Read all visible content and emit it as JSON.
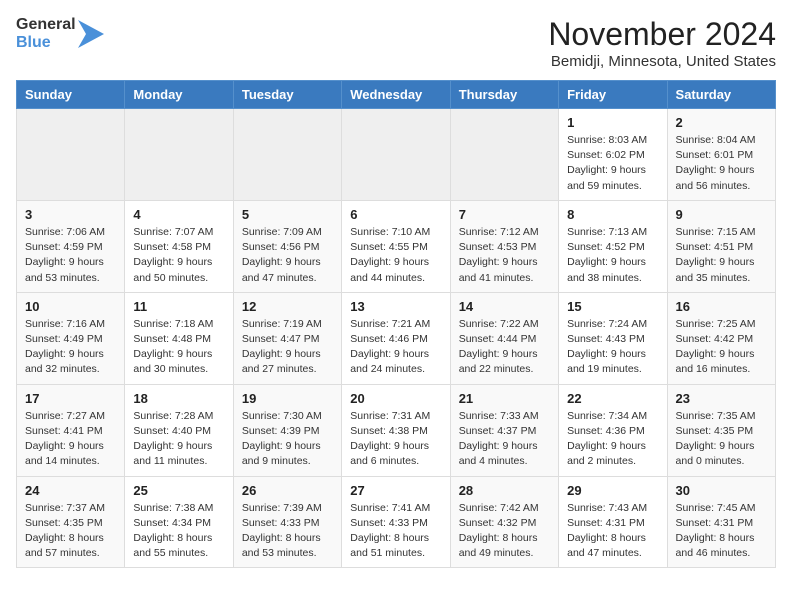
{
  "logo": {
    "line1": "General",
    "line2": "Blue"
  },
  "title": "November 2024",
  "location": "Bemidji, Minnesota, United States",
  "headers": [
    "Sunday",
    "Monday",
    "Tuesday",
    "Wednesday",
    "Thursday",
    "Friday",
    "Saturday"
  ],
  "weeks": [
    [
      {
        "day": "",
        "info": ""
      },
      {
        "day": "",
        "info": ""
      },
      {
        "day": "",
        "info": ""
      },
      {
        "day": "",
        "info": ""
      },
      {
        "day": "",
        "info": ""
      },
      {
        "day": "1",
        "info": "Sunrise: 8:03 AM\nSunset: 6:02 PM\nDaylight: 9 hours and 59 minutes."
      },
      {
        "day": "2",
        "info": "Sunrise: 8:04 AM\nSunset: 6:01 PM\nDaylight: 9 hours and 56 minutes."
      }
    ],
    [
      {
        "day": "3",
        "info": "Sunrise: 7:06 AM\nSunset: 4:59 PM\nDaylight: 9 hours and 53 minutes."
      },
      {
        "day": "4",
        "info": "Sunrise: 7:07 AM\nSunset: 4:58 PM\nDaylight: 9 hours and 50 minutes."
      },
      {
        "day": "5",
        "info": "Sunrise: 7:09 AM\nSunset: 4:56 PM\nDaylight: 9 hours and 47 minutes."
      },
      {
        "day": "6",
        "info": "Sunrise: 7:10 AM\nSunset: 4:55 PM\nDaylight: 9 hours and 44 minutes."
      },
      {
        "day": "7",
        "info": "Sunrise: 7:12 AM\nSunset: 4:53 PM\nDaylight: 9 hours and 41 minutes."
      },
      {
        "day": "8",
        "info": "Sunrise: 7:13 AM\nSunset: 4:52 PM\nDaylight: 9 hours and 38 minutes."
      },
      {
        "day": "9",
        "info": "Sunrise: 7:15 AM\nSunset: 4:51 PM\nDaylight: 9 hours and 35 minutes."
      }
    ],
    [
      {
        "day": "10",
        "info": "Sunrise: 7:16 AM\nSunset: 4:49 PM\nDaylight: 9 hours and 32 minutes."
      },
      {
        "day": "11",
        "info": "Sunrise: 7:18 AM\nSunset: 4:48 PM\nDaylight: 9 hours and 30 minutes."
      },
      {
        "day": "12",
        "info": "Sunrise: 7:19 AM\nSunset: 4:47 PM\nDaylight: 9 hours and 27 minutes."
      },
      {
        "day": "13",
        "info": "Sunrise: 7:21 AM\nSunset: 4:46 PM\nDaylight: 9 hours and 24 minutes."
      },
      {
        "day": "14",
        "info": "Sunrise: 7:22 AM\nSunset: 4:44 PM\nDaylight: 9 hours and 22 minutes."
      },
      {
        "day": "15",
        "info": "Sunrise: 7:24 AM\nSunset: 4:43 PM\nDaylight: 9 hours and 19 minutes."
      },
      {
        "day": "16",
        "info": "Sunrise: 7:25 AM\nSunset: 4:42 PM\nDaylight: 9 hours and 16 minutes."
      }
    ],
    [
      {
        "day": "17",
        "info": "Sunrise: 7:27 AM\nSunset: 4:41 PM\nDaylight: 9 hours and 14 minutes."
      },
      {
        "day": "18",
        "info": "Sunrise: 7:28 AM\nSunset: 4:40 PM\nDaylight: 9 hours and 11 minutes."
      },
      {
        "day": "19",
        "info": "Sunrise: 7:30 AM\nSunset: 4:39 PM\nDaylight: 9 hours and 9 minutes."
      },
      {
        "day": "20",
        "info": "Sunrise: 7:31 AM\nSunset: 4:38 PM\nDaylight: 9 hours and 6 minutes."
      },
      {
        "day": "21",
        "info": "Sunrise: 7:33 AM\nSunset: 4:37 PM\nDaylight: 9 hours and 4 minutes."
      },
      {
        "day": "22",
        "info": "Sunrise: 7:34 AM\nSunset: 4:36 PM\nDaylight: 9 hours and 2 minutes."
      },
      {
        "day": "23",
        "info": "Sunrise: 7:35 AM\nSunset: 4:35 PM\nDaylight: 9 hours and 0 minutes."
      }
    ],
    [
      {
        "day": "24",
        "info": "Sunrise: 7:37 AM\nSunset: 4:35 PM\nDaylight: 8 hours and 57 minutes."
      },
      {
        "day": "25",
        "info": "Sunrise: 7:38 AM\nSunset: 4:34 PM\nDaylight: 8 hours and 55 minutes."
      },
      {
        "day": "26",
        "info": "Sunrise: 7:39 AM\nSunset: 4:33 PM\nDaylight: 8 hours and 53 minutes."
      },
      {
        "day": "27",
        "info": "Sunrise: 7:41 AM\nSunset: 4:33 PM\nDaylight: 8 hours and 51 minutes."
      },
      {
        "day": "28",
        "info": "Sunrise: 7:42 AM\nSunset: 4:32 PM\nDaylight: 8 hours and 49 minutes."
      },
      {
        "day": "29",
        "info": "Sunrise: 7:43 AM\nSunset: 4:31 PM\nDaylight: 8 hours and 47 minutes."
      },
      {
        "day": "30",
        "info": "Sunrise: 7:45 AM\nSunset: 4:31 PM\nDaylight: 8 hours and 46 minutes."
      }
    ]
  ]
}
